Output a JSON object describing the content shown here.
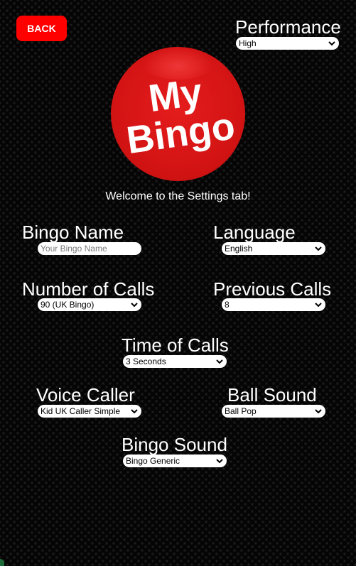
{
  "header": {
    "back_label": "BACK",
    "performance": {
      "label": "Performance",
      "value": "High"
    }
  },
  "logo": {
    "line1": "My",
    "line2": "Bingo",
    "color": "#d41414"
  },
  "welcome": "Welcome to the Settings tab!",
  "settings": {
    "bingo_name": {
      "label": "Bingo Name",
      "placeholder": "Your Bingo Name",
      "value": ""
    },
    "language": {
      "label": "Language",
      "value": "English"
    },
    "number_of_calls": {
      "label": "Number of Calls",
      "value": "90 (UK Bingo)"
    },
    "previous_calls": {
      "label": "Previous Calls",
      "value": "8"
    },
    "time_of_calls": {
      "label": "Time of Calls",
      "value": "3 Seconds"
    },
    "voice_caller": {
      "label": "Voice Caller",
      "value": "Kid UK Caller Simple"
    },
    "ball_sound": {
      "label": "Ball Sound",
      "value": "Ball Pop"
    },
    "bingo_sound": {
      "label": "Bingo Sound",
      "value": "Bingo Generic"
    }
  },
  "icons": {
    "dropdown": "chevron-down-icon"
  },
  "colors": {
    "accent": "#ff0000",
    "background": "#1e1e1e"
  }
}
